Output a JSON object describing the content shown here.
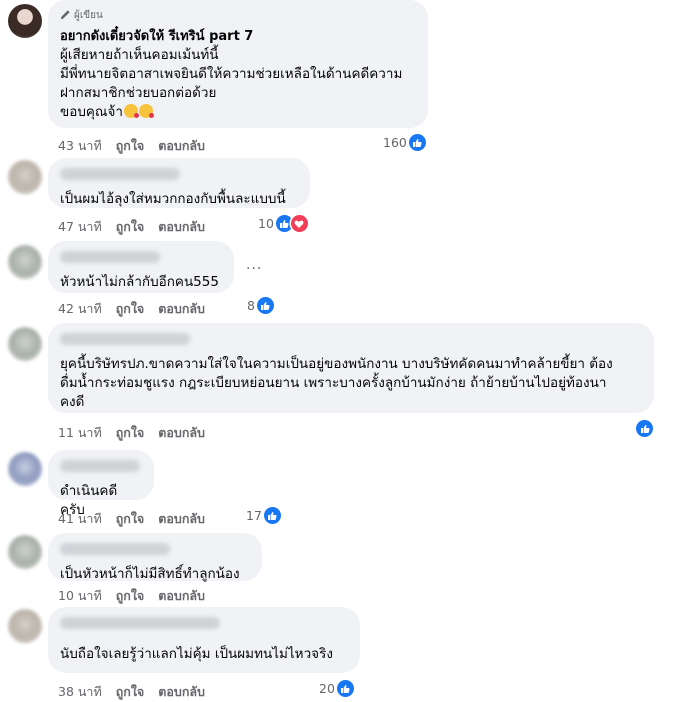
{
  "comments": [
    {
      "author_tag": "ผู้เขียน",
      "author_name": "อยากดังเดี๋ยวจัดให้ รีเทริน์ part 7",
      "text": "ผู้เสียหายถ้าเห็นคอมเม้นท์นี้\nมีพี่ทนายจิตอาสาเพจยินดีให้ความช่วยเหลือในด้านคดีความ\nฝากสมาชิกช่วยบอกต่อด้วย\nขอบคุณจ้า",
      "time": "43 นาที",
      "like": "ถูกใจ",
      "reply": "ตอบกลับ",
      "count": "160",
      "emoji_icon": "kiss-emoji-icon"
    },
    {
      "text": "เป็นผมไอ้ลุงใส่หมวกกองกับพื้นละแบบนี้",
      "time": "47 นาที",
      "like": "ถูกใจ",
      "reply": "ตอบกลับ",
      "count": "10"
    },
    {
      "text": "หัวหน้าไม่กล้ากับอีกคน555",
      "time": "42 นาที",
      "like": "ถูกใจ",
      "reply": "ตอบกลับ",
      "count": "8",
      "more": "..."
    },
    {
      "text": "ยุคนี้บริษัทรปภ.ขาดความใส่ใจในความเป็นอยู่ของพนักงาน บางบริษัทคัดคนมาทำคล้ายขี้ยา ต้อง\nดื่มน้ำกระท่อมชูแรง กฎระเบียบหย่อนยาน เพราะบางครั้งลูกบ้านมักง่าย ถ้าย้ายบ้านไปอยู่ท้องนา\nคงดี",
      "time": "11 นาที",
      "like": "ถูกใจ",
      "reply": "ตอบกลับ"
    },
    {
      "text": "ดำเนินคดีครับ",
      "time": "41 นาที",
      "like": "ถูกใจ",
      "reply": "ตอบกลับ",
      "count": "17"
    },
    {
      "text": "เป็นหัวหน้าก็ไม่มีสิทธิ์ทำลูกน้อง",
      "time": "10 นาที",
      "like": "ถูกใจ",
      "reply": "ตอบกลับ"
    },
    {
      "text": "นับถือใจเลยรู้ว่าแลกไม่คุ้ม เป็นผมทนไม่ไหวจริง",
      "time": "38 นาที",
      "like": "ถูกใจ",
      "reply": "ตอบกลับ",
      "count": "20"
    }
  ],
  "colors": {
    "like": "#1877f2",
    "heart": "#f33e58",
    "bubble": "#f0f2f5",
    "meta": "#65676b"
  }
}
